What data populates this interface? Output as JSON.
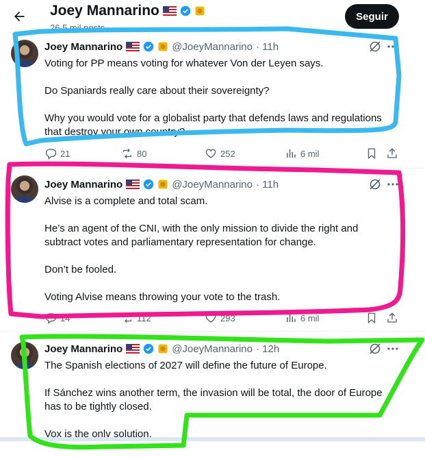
{
  "header": {
    "name": "Joey Mannarino",
    "posts_count": "26,5 mil posts",
    "follow_label": "Seguir"
  },
  "colors": {
    "blue_highlight": "#3bb9ef",
    "pink_highlight": "#ee1a8e",
    "green_highlight": "#33e21a",
    "verified_blue": "#1d9bf0",
    "gold_badge": "#f2b705"
  },
  "icons": [
    "back-arrow-icon",
    "us-flag-icon",
    "verified-icon",
    "gold-badge-icon",
    "grok-icon",
    "more-icon",
    "reply-icon",
    "repost-icon",
    "like-icon",
    "views-icon",
    "bookmark-icon",
    "share-icon"
  ],
  "tweets": [
    {
      "name": "Joey Mannarino",
      "handle": "@JoeyMannarino",
      "time": "· 11h",
      "paragraphs": [
        "Voting for PP means voting for whatever Von der Leyen says.",
        "Do Spaniards really care about their sovereignty?",
        "Why you would vote for a globalist party that defends laws and regulations that destroy your own country?"
      ],
      "replies": "21",
      "reposts": "80",
      "likes": "252",
      "views": "6 mil"
    },
    {
      "name": "Joey Mannarino",
      "handle": "@JoeyMannarino",
      "time": "· 11h",
      "paragraphs": [
        "Alvise is a complete and total scam.",
        "He’s an agent of the CNI, with the only mission to divide the right and subtract votes and parliamentary representation for change.",
        "Don’t be fooled.",
        "Voting Alvise means throwing your vote to the trash."
      ],
      "replies": "14",
      "reposts": "112",
      "likes": "293",
      "views": "6 mil"
    },
    {
      "name": "Joey Mannarino",
      "handle": "@JoeyMannarino",
      "time": "· 12h",
      "paragraphs": [
        "The Spanish elections of 2027 will define the future of Europe.",
        "If Sánchez wins another term, the invasion will be total, the door of Europe has to be tightly closed.",
        "Vox is the only solution."
      ]
    }
  ]
}
